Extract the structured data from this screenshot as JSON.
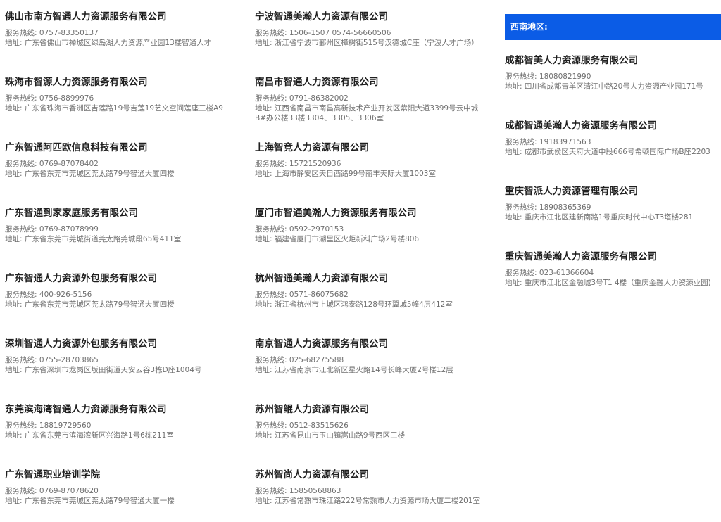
{
  "labels": {
    "hotline": "服务热线: ",
    "address": "地址: "
  },
  "col1": [
    {
      "name": "佛山市南方智通人力资源服务有限公司",
      "phone": "0757-83350137",
      "address": "广东省佛山市禅城区绿岛湖人力资源产业园13楼智通人才"
    },
    {
      "name": "珠海市智源人力资源服务有限公司",
      "phone": "0756-8899976",
      "address": "广东省珠海市香洲区吉莲路19号吉莲19艺文空间莲座三楼A9"
    },
    {
      "name": "广东智通阿匹欧信息科技有限公司",
      "phone": "0769-87078402",
      "address": "广东省东莞市莞城区莞太路79号智通大厦四楼"
    },
    {
      "name": "广东智通到家家庭服务有限公司",
      "phone": "0769-87078999",
      "address": "广东省东莞市莞城街道莞太路莞城段65号411室"
    },
    {
      "name": "广东智通人力资源外包服务有限公司",
      "phone": "400-926-5156",
      "address": "广东省东莞市莞城区莞太路79号智通大厦四楼"
    },
    {
      "name": "深圳智通人力资源外包服务有限公司",
      "phone": "0755-28703865",
      "address": "广东省深圳市龙岗区坂田街道天安云谷3栋D座1004号"
    },
    {
      "name": "东莞滨海湾智通人力资源服务有限公司",
      "phone": "18819729560",
      "address": "广东省东莞市滨海湾新区兴海路1号6栋211室"
    },
    {
      "name": "广东智通职业培训学院",
      "phone": "0769-87078620",
      "address": "广东省东莞市莞城区莞太路79号智通大厦一楼"
    }
  ],
  "col2": [
    {
      "name": "宁波智通美瀚人力资源有限公司",
      "phone": "1506-1507 0574-56660506",
      "address": "浙江省宁波市鄞州区樟树街515号汉德城C座（宁波人才广场）"
    },
    {
      "name": "南昌市智通人力资源有限公司",
      "phone": "0791-86382002",
      "address": "江西省南昌市南昌高新技术产业开发区紫阳大道3399号云中城B#办公楼33楼3304、3305、3306室"
    },
    {
      "name": "上海智竞人力资源有限公司",
      "phone": "15721520936",
      "address": "上海市静安区天目西路99号丽丰天际大厦1003室"
    },
    {
      "name": "厦门市智通美瀚人力资源服务有限公司",
      "phone": "0592-2970153",
      "address": "福建省厦门市湖里区火炬新科广场2号楼806"
    },
    {
      "name": "杭州智通美瀚人力资源有限公司",
      "phone": "0571-86075682",
      "address": "浙江省杭州市上城区鸿泰路128号环翼城5幢4层412室"
    },
    {
      "name": "南京智通人力资源服务有限公司",
      "phone": "025-68275588",
      "address": "江苏省南京市江北新区星火路14号长峰大厦2号楼12层"
    },
    {
      "name": "苏州智鲲人力资源有限公司",
      "phone": "0512-83515626",
      "address": "江苏省昆山市玉山镇嵩山路9号西区三楼"
    },
    {
      "name": "苏州智尚人力资源有限公司",
      "phone": "15850568863",
      "address": "江苏省常熟市珠江路222号常熟市人力资源市场大厦二楼201室"
    }
  ],
  "col3": {
    "region_label": "西南地区:",
    "companies": [
      {
        "name": "成都智美人力资源服务有限公司",
        "phone": "18080821990",
        "address": "四川省成都青羊区清江中路20号人力资源产业园171号"
      },
      {
        "name": "成都智通美瀚人力资源服务有限公司",
        "phone": "19183971563",
        "address": "成都市武侯区天府大道中段666号希顿国际广场B座2203"
      },
      {
        "name": "重庆智派人力资源管理有限公司",
        "phone": "18908365369",
        "address": "重庆市江北区建新南路1号重庆时代中心T3塔楼281"
      },
      {
        "name": "重庆智通美瀚人力资源服务有限公司",
        "phone": "023-61366604",
        "address": "重庆市江北区金融城3号T1 4楼（重庆金融人力资源业园)"
      }
    ]
  }
}
